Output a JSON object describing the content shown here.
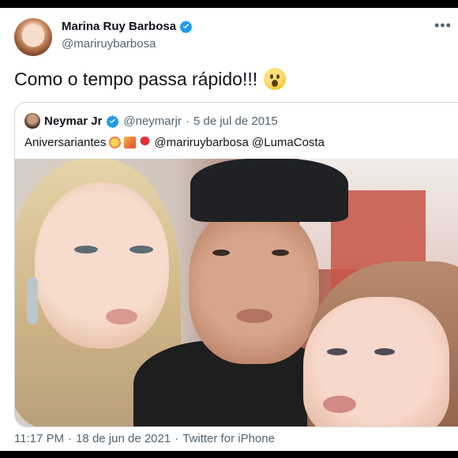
{
  "tweet": {
    "author_name": "Marina Ruy Barbosa",
    "author_handle": "@mariruybarbosa",
    "text": "Como o tempo passa rápido!!!",
    "timestamp": "11:17 PM",
    "date": "18 de jun de 2021",
    "source": "Twitter for iPhone",
    "separator": "·",
    "more_icon": "more-horizontal-icon"
  },
  "quoted": {
    "author_name": "Neymar Jr",
    "author_handle": "@neymarjr",
    "separator": "·",
    "date": "5 de jul de 2015",
    "text": "Aniversariantes",
    "mentions": "@mariruybarbosa @LumaCosta"
  },
  "colors": {
    "verified": "#1d9bf0",
    "secondary_text": "#536471",
    "primary_text": "#0f1419",
    "border": "#cfd9de"
  }
}
